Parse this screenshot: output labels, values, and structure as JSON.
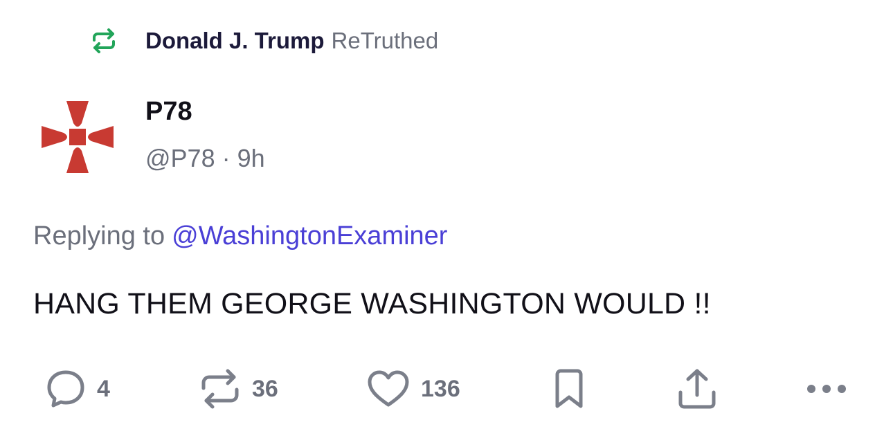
{
  "retruth": {
    "user": "Donald J. Trump",
    "label": "ReTruthed",
    "icon": "retruth-icon",
    "icon_color": "#22a55a"
  },
  "post": {
    "author_name": "P78",
    "author_handle": "@P78",
    "separator": "·",
    "time": "9h",
    "avatar_icon": "red-cross-pattee-icon",
    "avatar_color": "#c83a32",
    "replying_label": "Replying to",
    "replying_to": "@WashingtonExaminer",
    "text": "HANG THEM GEORGE WASHINGTON WOULD !!"
  },
  "actions": {
    "reply_count": "4",
    "retruth_count": "36",
    "like_count": "136",
    "icons": [
      "comment-icon",
      "retruth-icon",
      "heart-icon",
      "bookmark-icon",
      "share-icon",
      "more-icon"
    ],
    "icon_color": "#7b7f8a"
  },
  "colors": {
    "text": "#111018",
    "muted": "#6b6f7b",
    "link": "#4a3fd6"
  }
}
